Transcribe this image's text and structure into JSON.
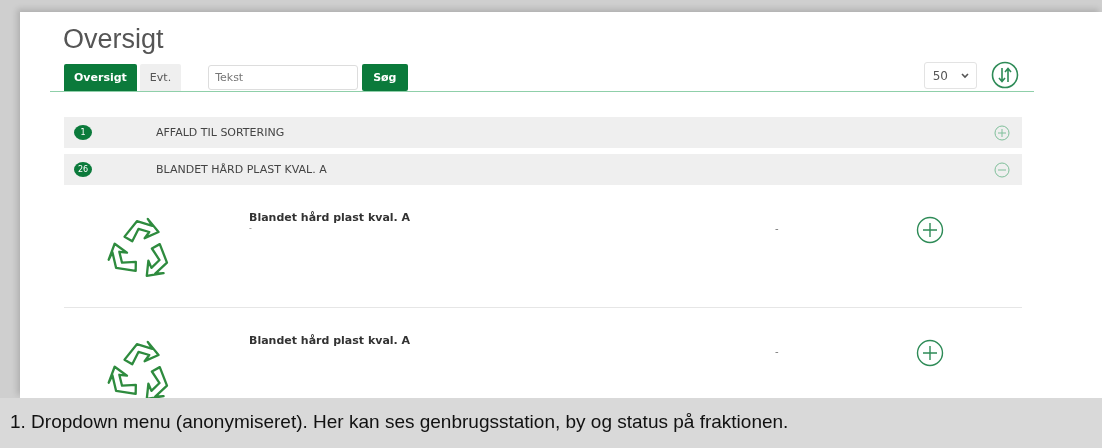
{
  "page_title": "Oversigt",
  "tabs": [
    {
      "label": "Oversigt",
      "selected": true
    },
    {
      "label": "Evt.",
      "selected": false
    }
  ],
  "search": {
    "placeholder": "Tekst",
    "button": "Søg"
  },
  "page_size": "50",
  "groups": [
    {
      "count": "1",
      "title": "AFFALD TIL SORTERING",
      "expanded": false
    },
    {
      "count": "26",
      "title": "BLANDET HÅRD PLAST KVAL. A",
      "expanded": true,
      "items": [
        {
          "name": "Blandet hård plast kval. A",
          "detail": "-",
          "column_2": "-"
        },
        {
          "name": "Blandet hård plast kval. A",
          "column_2": "-"
        }
      ]
    }
  ],
  "caption": "1. Dropdown menu (anonymiseret). Her kan ses genbrugsstation, by og status på fraktionen."
}
